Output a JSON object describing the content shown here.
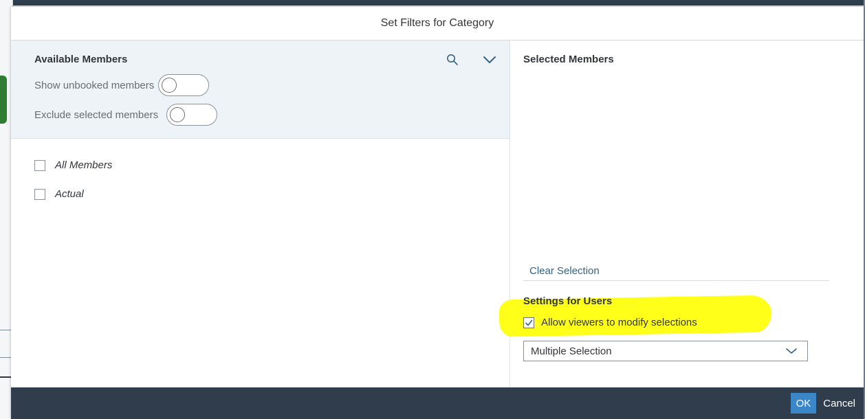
{
  "dialog": {
    "title": "Set Filters for Category"
  },
  "available": {
    "title": "Available Members",
    "search_icon": "search-icon",
    "expand_icon": "chevron-down-icon",
    "toggles": [
      {
        "label": "Show unbooked members",
        "on": false
      },
      {
        "label": "Exclude selected members",
        "on": false
      }
    ],
    "members": [
      {
        "label": "All Members",
        "checked": false
      },
      {
        "label": "Actual",
        "checked": false
      }
    ]
  },
  "selected": {
    "title": "Selected Members",
    "clear_label": "Clear Selection"
  },
  "settings": {
    "title": "Settings for Users",
    "allow_label": "Allow viewers to modify selections",
    "allow_checked": true,
    "mode_value": "Multiple Selection"
  },
  "footer": {
    "ok_label": "OK",
    "cancel_label": "Cancel"
  },
  "colors": {
    "accent": "#3b86c7",
    "footer_bg": "#2f3d4c",
    "link": "#346187",
    "highlight": "#ffff1a",
    "pane_bg": "#eef3f8"
  }
}
